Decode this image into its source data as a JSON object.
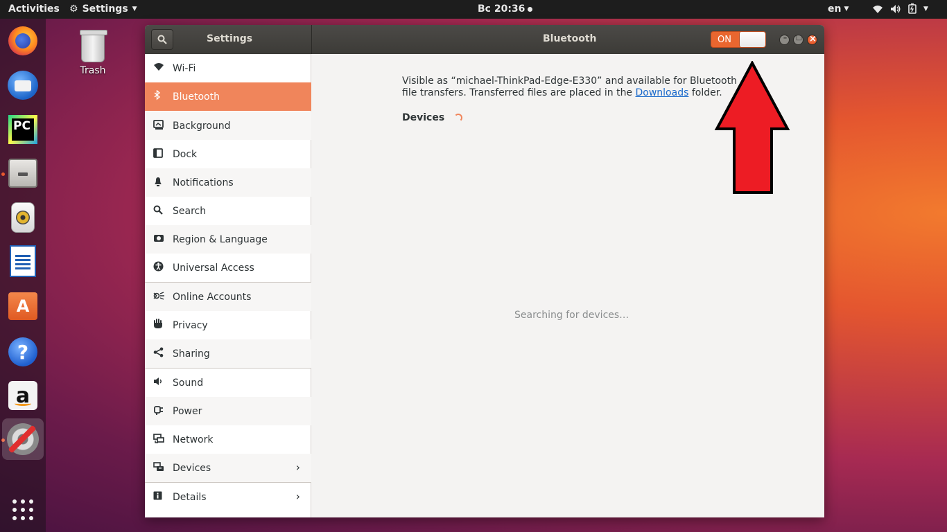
{
  "topbar": {
    "activities": "Activities",
    "app_menu": "Settings",
    "clock": "Вс 20:36",
    "lang": "en"
  },
  "desktop": {
    "trash_label": "Trash"
  },
  "window": {
    "sidebar_title": "Settings",
    "title": "Bluetooth",
    "toggle_label": "ON"
  },
  "sidebar": {
    "items": [
      {
        "label": "Wi-Fi",
        "icon": "wifi-icon"
      },
      {
        "label": "Bluetooth",
        "icon": "bluetooth-icon"
      },
      {
        "label": "Background",
        "icon": "background-icon"
      },
      {
        "label": "Dock",
        "icon": "dock-icon"
      },
      {
        "label": "Notifications",
        "icon": "bell-icon"
      },
      {
        "label": "Search",
        "icon": "search-icon"
      },
      {
        "label": "Region & Language",
        "icon": "camera-icon"
      },
      {
        "label": "Universal Access",
        "icon": "accessibility-icon"
      },
      {
        "label": "Online Accounts",
        "icon": "online-accounts-icon"
      },
      {
        "label": "Privacy",
        "icon": "hand-icon"
      },
      {
        "label": "Sharing",
        "icon": "share-icon"
      },
      {
        "label": "Sound",
        "icon": "speaker-icon"
      },
      {
        "label": "Power",
        "icon": "power-plug-icon"
      },
      {
        "label": "Network",
        "icon": "network-icon"
      },
      {
        "label": "Devices",
        "icon": "devices-icon"
      },
      {
        "label": "Details",
        "icon": "info-icon"
      }
    ]
  },
  "content": {
    "description_pre": "Visible as “michael-ThinkPad-Edge-E330” and available for Bluetooth file transfers. Transferred files are placed in the ",
    "downloads_link": "Downloads",
    "description_post": " folder.",
    "devices_heading": "Devices",
    "searching": "Searching for devices…"
  },
  "colors": {
    "accent": "#f0855b",
    "toggle_on": "#e9662f",
    "arrow": "#ed1c24"
  }
}
